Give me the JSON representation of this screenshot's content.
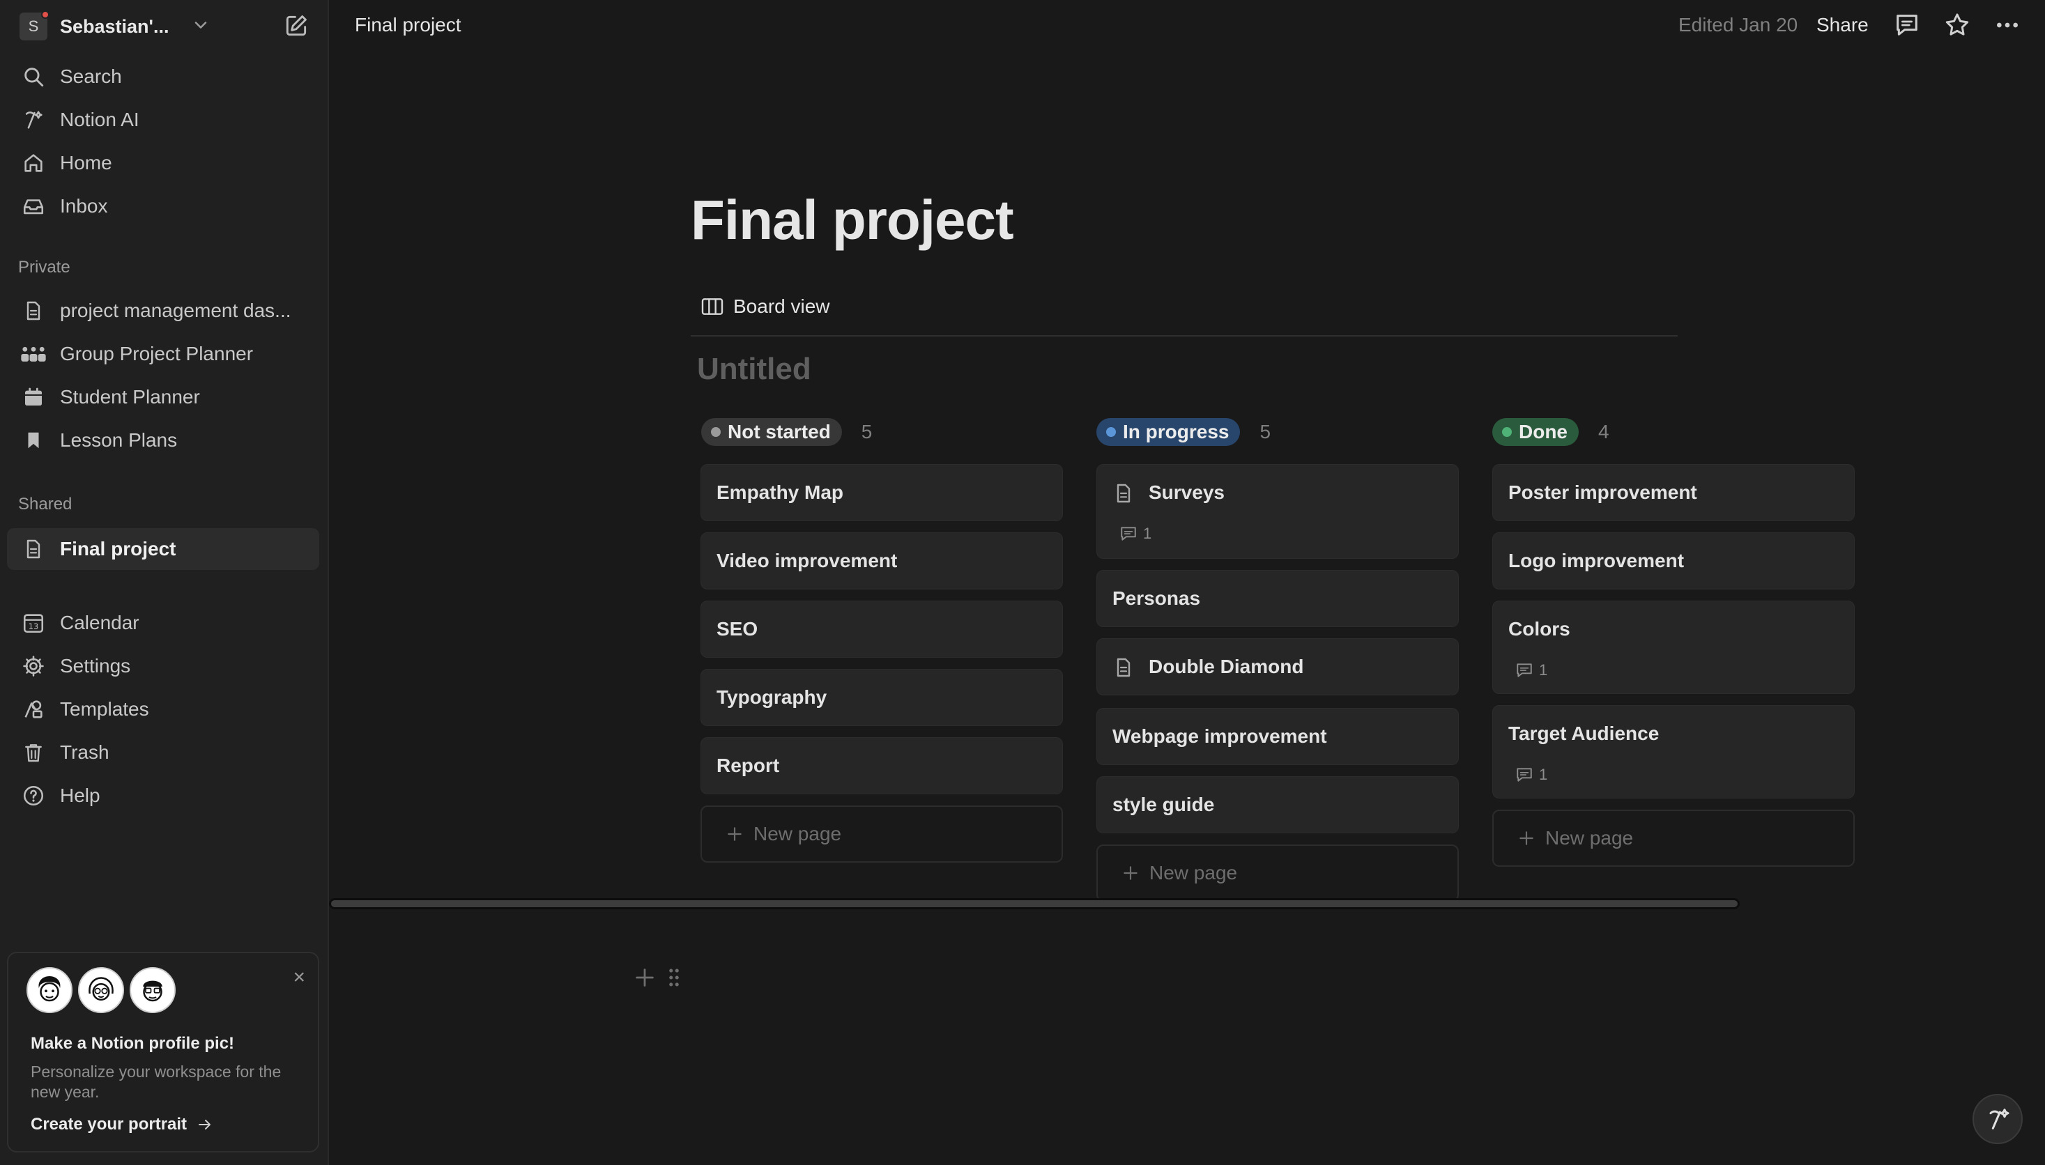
{
  "workspace": {
    "initial": "S",
    "name": "Sebastian'..."
  },
  "sidebar": {
    "top_items": [
      {
        "label": "Search",
        "icon": "search-icon"
      },
      {
        "label": "Notion AI",
        "icon": "notion-ai-icon"
      },
      {
        "label": "Home",
        "icon": "home-icon"
      },
      {
        "label": "Inbox",
        "icon": "inbox-icon"
      }
    ],
    "private_label": "Private",
    "private_items": [
      {
        "label": "project management das...",
        "icon": "page-icon"
      },
      {
        "label": "Group Project Planner",
        "icon": "group-icon"
      },
      {
        "label": "Student Planner",
        "icon": "calendar-icon"
      },
      {
        "label": "Lesson Plans",
        "icon": "bookmark-icon"
      }
    ],
    "shared_label": "Shared",
    "shared_items": [
      {
        "label": "Final project",
        "icon": "page-icon",
        "active": true
      }
    ],
    "bottom_items": [
      {
        "label": "Calendar",
        "icon": "calendar-13-icon"
      },
      {
        "label": "Settings",
        "icon": "gear-icon"
      },
      {
        "label": "Templates",
        "icon": "templates-icon"
      },
      {
        "label": "Trash",
        "icon": "trash-icon"
      },
      {
        "label": "Help",
        "icon": "help-icon"
      }
    ],
    "promo": {
      "title": "Make a Notion profile pic!",
      "body": "Personalize your workspace for the new year.",
      "cta": "Create your portrait"
    }
  },
  "topbar": {
    "breadcrumb": "Final project",
    "edited": "Edited Jan 20",
    "share": "Share"
  },
  "page": {
    "title": "Final project",
    "view_tab": "Board view",
    "database_title": "Untitled"
  },
  "board": {
    "columns": [
      {
        "status": "Not started",
        "count": "5",
        "pill_bg": "#373737",
        "dot_color": "#9b9b9b",
        "cards": [
          {
            "title": "Empathy Map"
          },
          {
            "title": "Video improvement"
          },
          {
            "title": "SEO"
          },
          {
            "title": "Typography"
          },
          {
            "title": "Report"
          }
        ],
        "new_page": "New page"
      },
      {
        "status": "In progress",
        "count": "5",
        "pill_bg": "#28456c",
        "dot_color": "#5b97d8",
        "cards": [
          {
            "title": "Surveys",
            "has_doc_icon": true,
            "comments": "1"
          },
          {
            "title": "Personas"
          },
          {
            "title": "Double Diamond",
            "has_doc_icon": true
          },
          {
            "title": "Webpage improvement"
          },
          {
            "title": "style guide"
          }
        ],
        "new_page": "New page"
      },
      {
        "status": "Done",
        "count": "4",
        "pill_bg": "#2b5b3d",
        "dot_color": "#4fb377",
        "cards": [
          {
            "title": "Poster improvement"
          },
          {
            "title": "Logo improvement"
          },
          {
            "title": "Colors",
            "comments": "1"
          },
          {
            "title": "Target Audience",
            "comments": "1"
          }
        ],
        "new_page": "New page"
      }
    ]
  }
}
